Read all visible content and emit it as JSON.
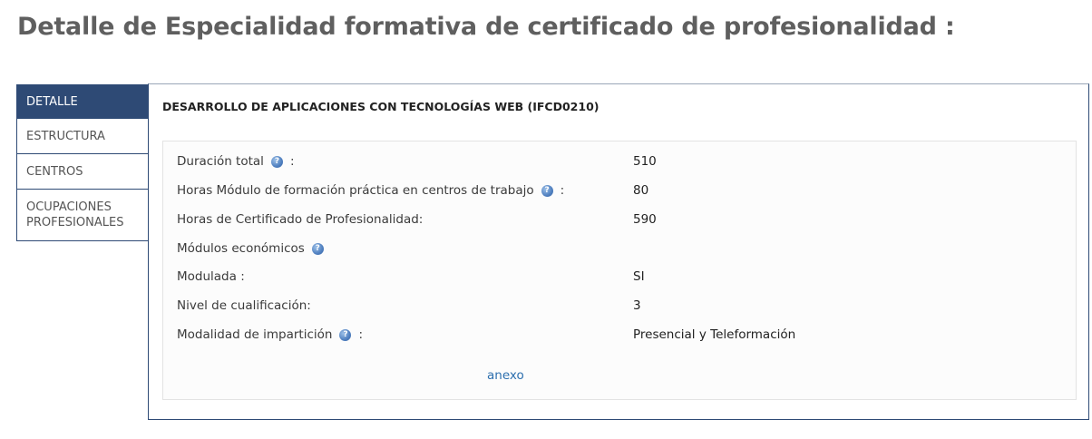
{
  "page": {
    "title": "Detalle de Especialidad formativa de certificado de profesionalidad :"
  },
  "tabs": [
    {
      "label": "DETALLE",
      "active": true
    },
    {
      "label": "ESTRUCTURA",
      "active": false
    },
    {
      "label": "CENTROS",
      "active": false
    },
    {
      "label": "OCUPACIONES PROFESIONALES",
      "active": false
    }
  ],
  "panel": {
    "title": "DESARROLLO DE APLICACIONES CON TECNOLOGÍAS WEB (IFCD0210)",
    "help_icon_glyph": "?",
    "rows": [
      {
        "label": "Duración total",
        "has_help": true,
        "colon": ":",
        "value": "510"
      },
      {
        "label": "Horas Módulo de formación práctica en centros de trabajo",
        "has_help": true,
        "colon": ":",
        "value": "80"
      },
      {
        "label": "Horas de Certificado de Profesionalidad:",
        "has_help": false,
        "colon": "",
        "value": "590"
      },
      {
        "label": "Módulos económicos",
        "has_help": true,
        "colon": "",
        "value": ""
      },
      {
        "label": "Modulada :",
        "has_help": false,
        "colon": "",
        "value": "SI"
      },
      {
        "label": "Nivel de cualificación:",
        "has_help": false,
        "colon": "",
        "value": "3"
      },
      {
        "label": "Modalidad de impartición",
        "has_help": true,
        "colon": ":",
        "value": "Presencial y Teleformación"
      }
    ],
    "link_label": "anexo"
  },
  "colors": {
    "accent": "#2e4a75",
    "link": "#2d6fae",
    "title_text": "#5f5f5f"
  },
  "icons": {
    "help": "help-icon"
  }
}
